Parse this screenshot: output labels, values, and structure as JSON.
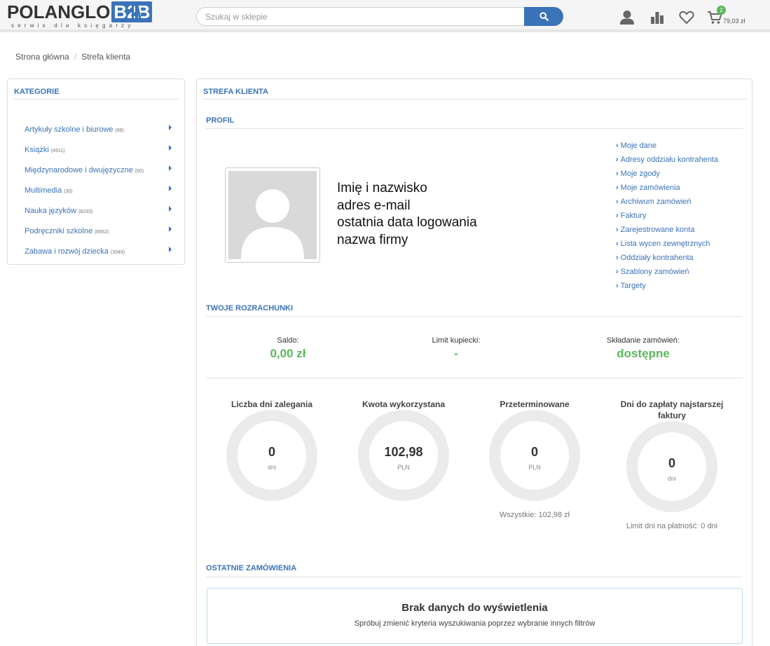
{
  "header": {
    "logo_text": "POLANGLO",
    "logo_badge": "B2B",
    "logo_tagline": "serwis dla księgarzy",
    "search_placeholder": "Szukaj w sklepie",
    "cart_count": "2",
    "cart_total": "79,03 zł",
    "icons": [
      "user-icon",
      "stats-icon",
      "heart-icon",
      "cart-icon",
      "search-icon"
    ],
    "accent_color": "#3b73b9",
    "success_color": "#5cb85c"
  },
  "breadcrumb": [
    "Strona główna",
    "Strefa klienta"
  ],
  "categories": {
    "title": "KATEGORIE",
    "items": [
      {
        "label": "Artykuły szkolne i biurowe",
        "count": "(88)"
      },
      {
        "label": "Książki",
        "count": "(4911)"
      },
      {
        "label": "Międzynarodowe i dwujęzyczne",
        "count": "(60)"
      },
      {
        "label": "Multimedia",
        "count": "(30)"
      },
      {
        "label": "Nauka języków",
        "count": "(8233)"
      },
      {
        "label": "Podręczniki szkolne",
        "count": "(6652)"
      },
      {
        "label": "Zabawa i rozwój dziecka",
        "count": "(3049)"
      }
    ]
  },
  "main": {
    "title": "STREFA KLIENTA",
    "profile": {
      "title": "PROFIL",
      "lines": [
        "Imię i nazwisko",
        "adres e-mail",
        "ostatnia data logowania",
        "nazwa firmy"
      ],
      "links": [
        "Moje dane",
        "Adresy oddziału kontrahenta",
        "Moje zgody",
        "Moje zamówienia",
        "Archiwum zamówień",
        "Faktury",
        "Zarejestrowane konta",
        "Lista wycen zewnętrznych",
        "Oddziały kontrahenta",
        "Szablony zamówień",
        "Targety"
      ]
    },
    "settlements": {
      "title": "TWOJE ROZRACHUNKI",
      "saldo_label": "Saldo:",
      "saldo_value": "0,00 zł",
      "limit_label": "Limit kupiecki:",
      "limit_value": "-",
      "orders_label": "Składanie zamówień:",
      "orders_value": "dostępne",
      "rings": [
        {
          "label": "Liczba dni zalegania",
          "value": "0",
          "unit": "dni",
          "note": ""
        },
        {
          "label": "Kwota wykorzystana",
          "value": "102,98",
          "unit": "PLN",
          "note": ""
        },
        {
          "label": "Przeterminowane",
          "value": "0",
          "unit": "PLN",
          "note": "Wszystkie: 102,98 zł"
        },
        {
          "label": "Dni do zapłaty najstarszej faktury",
          "value": "0",
          "unit": "dni",
          "note": "Limit dni na płatność: 0 dni"
        }
      ]
    },
    "recent_orders": {
      "title": "OSTATNIE ZAMÓWIENIA",
      "empty_title": "Brak danych do wyświetlenia",
      "empty_sub": "Spróbuj zmienić kryteria wyszukiwania poprzez wybranie innych filtrów"
    }
  }
}
